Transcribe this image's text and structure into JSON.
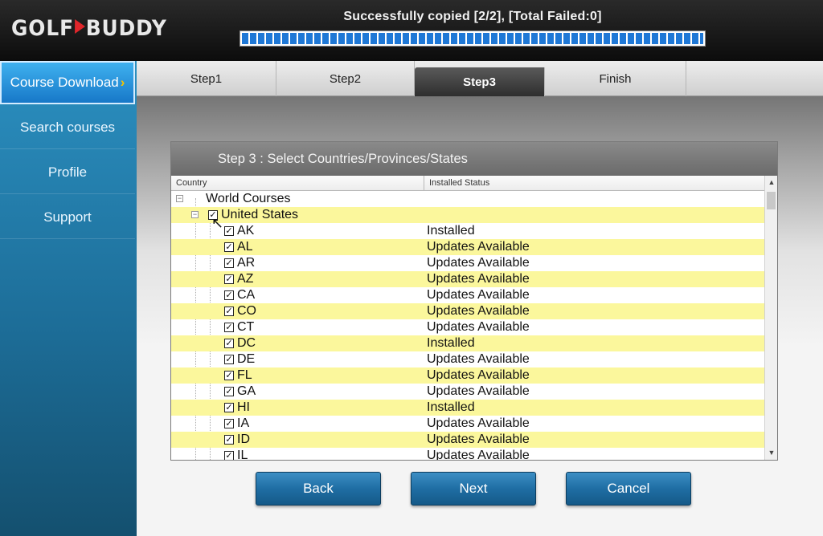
{
  "header": {
    "logo_text_left": "GOLF",
    "logo_text_right": "BUDDY",
    "status": "Successfully copied [2/2], [Total Failed:0]",
    "progress_fraction": 1.0
  },
  "sidebar": {
    "items": [
      {
        "label": "Course Download",
        "active": true
      },
      {
        "label": "Search courses",
        "active": false
      },
      {
        "label": "Profile",
        "active": false
      },
      {
        "label": "Support",
        "active": false
      }
    ]
  },
  "tabs": [
    {
      "label": "Step1",
      "active": false
    },
    {
      "label": "Step2",
      "active": false
    },
    {
      "label": "Step3",
      "active": true
    },
    {
      "label": "Finish",
      "active": false
    }
  ],
  "panel": {
    "title": "Step 3 : Select Countries/Provinces/States",
    "columns": {
      "country": "Country",
      "status": "Installed Status"
    }
  },
  "tree": {
    "root": {
      "label": "World Courses"
    },
    "country": {
      "label": "United States",
      "checked": true
    },
    "states": [
      {
        "code": "AK",
        "status": "Installed",
        "checked": true
      },
      {
        "code": "AL",
        "status": "Updates Available",
        "checked": true
      },
      {
        "code": "AR",
        "status": "Updates Available",
        "checked": true
      },
      {
        "code": "AZ",
        "status": "Updates Available",
        "checked": true
      },
      {
        "code": "CA",
        "status": "Updates Available",
        "checked": true
      },
      {
        "code": "CO",
        "status": "Updates Available",
        "checked": true
      },
      {
        "code": "CT",
        "status": "Updates Available",
        "checked": true
      },
      {
        "code": "DC",
        "status": "Installed",
        "checked": true
      },
      {
        "code": "DE",
        "status": "Updates Available",
        "checked": true
      },
      {
        "code": "FL",
        "status": "Updates Available",
        "checked": true
      },
      {
        "code": "GA",
        "status": "Updates Available",
        "checked": true
      },
      {
        "code": "HI",
        "status": "Installed",
        "checked": true
      },
      {
        "code": "IA",
        "status": "Updates Available",
        "checked": true
      },
      {
        "code": "ID",
        "status": "Updates Available",
        "checked": true
      },
      {
        "code": "IL",
        "status": "Updates Available",
        "checked": true
      }
    ]
  },
  "buttons": {
    "back": "Back",
    "next": "Next",
    "cancel": "Cancel"
  },
  "colors": {
    "highlight_row": "#fbf79c",
    "progress_fill": "#1f78d6",
    "logo_accent": "#e0262b",
    "active_chevron": "#f5c400"
  }
}
